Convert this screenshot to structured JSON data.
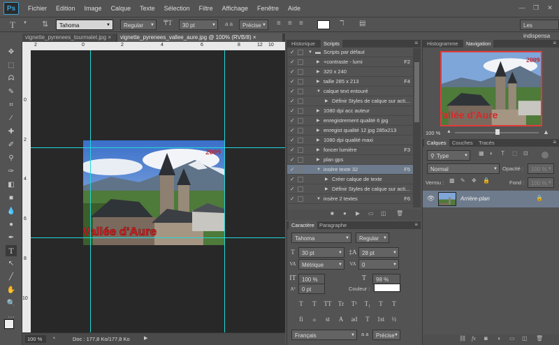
{
  "app": {
    "logo": "Ps"
  },
  "menu": [
    "Fichier",
    "Edition",
    "Image",
    "Calque",
    "Texte",
    "Sélection",
    "Filtre",
    "Affichage",
    "Fenêtre",
    "Aide"
  ],
  "window_controls": {
    "minimize": "—",
    "restore": "❐",
    "close": "✕"
  },
  "options_bar": {
    "font_family": "Tahoma",
    "font_style": "Regular",
    "font_size": "30 pt",
    "aa_label": "a a",
    "antialias": "Précise",
    "workspace": "Les indispensa"
  },
  "document_tabs": [
    {
      "label": "vignette_pyrenees_tourmalet.jpg",
      "close": "×"
    },
    {
      "label": "vignette_pyrenees_vallee_aure.jpg @ 100% (RVB/8)",
      "close": "×"
    }
  ],
  "ruler_top": [
    "2",
    "0",
    "2",
    "4",
    "6",
    "8",
    "10",
    "12"
  ],
  "ruler_left": [
    "0",
    "2",
    "4",
    "6",
    "8",
    "10"
  ],
  "canvas_image": {
    "caption": "Vallée d'Aure",
    "year": "2009"
  },
  "status": {
    "zoom": "100 %",
    "doc": "Doc : 177,8 Ko/177,8 Ko"
  },
  "scripts_panel": {
    "tabs": [
      "Historique",
      "Scripts"
    ],
    "rows": [
      {
        "label": "Scripts par défaut",
        "key": "",
        "level": 0,
        "folder": true,
        "open": true
      },
      {
        "label": "+contraste - lumi",
        "key": "F2",
        "level": 1
      },
      {
        "label": "320 x 240",
        "key": "",
        "level": 1
      },
      {
        "label": "taille 285 x 213",
        "key": "F4",
        "level": 1
      },
      {
        "label": "calque text entouré",
        "key": "",
        "level": 1,
        "open": true
      },
      {
        "label": "Définir Styles de calque sur acti...",
        "key": "",
        "level": 2
      },
      {
        "label": "1080 dpi acc auteur",
        "key": "",
        "level": 1
      },
      {
        "label": "enregistrement qualité 6 jpg",
        "key": "",
        "level": 1
      },
      {
        "label": "enregist qualité 12 jpg 285x213",
        "key": "",
        "level": 1
      },
      {
        "label": "1080 dpi qualité maxi",
        "key": "",
        "level": 1
      },
      {
        "label": "foncer lumière",
        "key": "F3",
        "level": 1
      },
      {
        "label": "plan gps",
        "key": "",
        "level": 1
      },
      {
        "label": "insère texte 32",
        "key": "F5",
        "level": 1,
        "open": true,
        "selected": true
      },
      {
        "label": "Créer calque de texte",
        "key": "",
        "level": 2
      },
      {
        "label": "Définir Styles de calque sur acti...",
        "key": "",
        "level": 2
      },
      {
        "label": "insère 2 textes",
        "key": "F6",
        "level": 1,
        "open": true
      }
    ]
  },
  "character_panel": {
    "tabs": [
      "Caractère",
      "Paragraphe"
    ],
    "font_family": "Tahoma",
    "font_style": "Regular",
    "size": "30 pt",
    "leading": "28 pt",
    "kerning": "Métrique",
    "tracking": "0",
    "vscale": "100 %",
    "hscale": "98 %",
    "baseline": "0 pt",
    "color_label": "Couleur :",
    "style_buttons": [
      "T",
      "T",
      "TT",
      "Tr",
      "T¹",
      "T₁",
      "T",
      "T"
    ],
    "opentype_buttons": [
      "fi",
      "ℴ",
      "st",
      "A",
      "ad",
      "T",
      "1st",
      "½"
    ],
    "language": "Français",
    "aa_label": "a a",
    "antialias": "Précise"
  },
  "navigator_panel": {
    "tabs": [
      "Histogramme",
      "Navigation"
    ],
    "zoom": "100 %"
  },
  "layers_panel": {
    "tabs": [
      "Calques",
      "Couches",
      "Tracés"
    ],
    "filter": "Type",
    "blend": "Normal",
    "opacity_label": "Opacité :",
    "opacity": "100 %",
    "lock_label": "Verrou :",
    "fill_label": "Fond :",
    "fill": "100 %",
    "layers": [
      {
        "name": "Arrière-plan",
        "locked": true
      }
    ]
  }
}
